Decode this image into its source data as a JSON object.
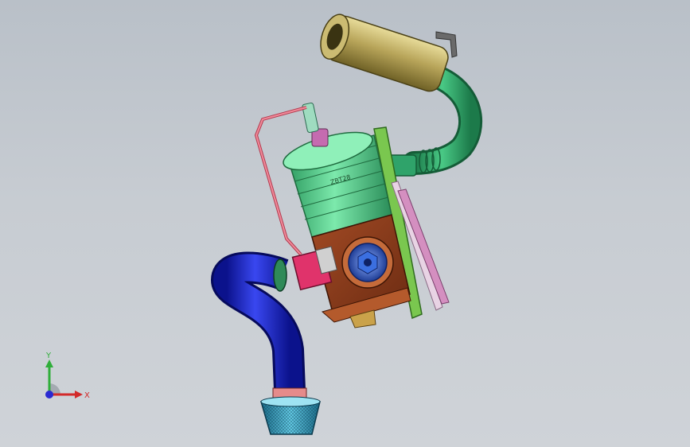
{
  "viewport": {
    "background_top": "#b9c0c8",
    "background_bottom": "#cfd3d8"
  },
  "model": {
    "cylinder_stamp": "ZBT28",
    "parts": [
      {
        "name": "muffler",
        "color": "#b8a55a"
      },
      {
        "name": "exhaust-pipe",
        "color": "#2fa36a"
      },
      {
        "name": "cylinder",
        "color": "#52d38d"
      },
      {
        "name": "crankcase",
        "color": "#8a3b1c"
      },
      {
        "name": "flywheel-hub",
        "color": "#2b5fbf"
      },
      {
        "name": "mount-plate",
        "color": "#7ac74f"
      },
      {
        "name": "intake-duct",
        "color": "#1726c7"
      },
      {
        "name": "air-filter",
        "color": "#3aa7c8"
      },
      {
        "name": "fuel-line",
        "color": "#e0566b"
      },
      {
        "name": "carburetor",
        "color": "#e0336b"
      }
    ]
  },
  "triad": {
    "x_label": "X",
    "y_label": "Y",
    "x_color": "#d22a2a",
    "y_color": "#2fae3a",
    "origin_color": "#2a2ad2"
  }
}
